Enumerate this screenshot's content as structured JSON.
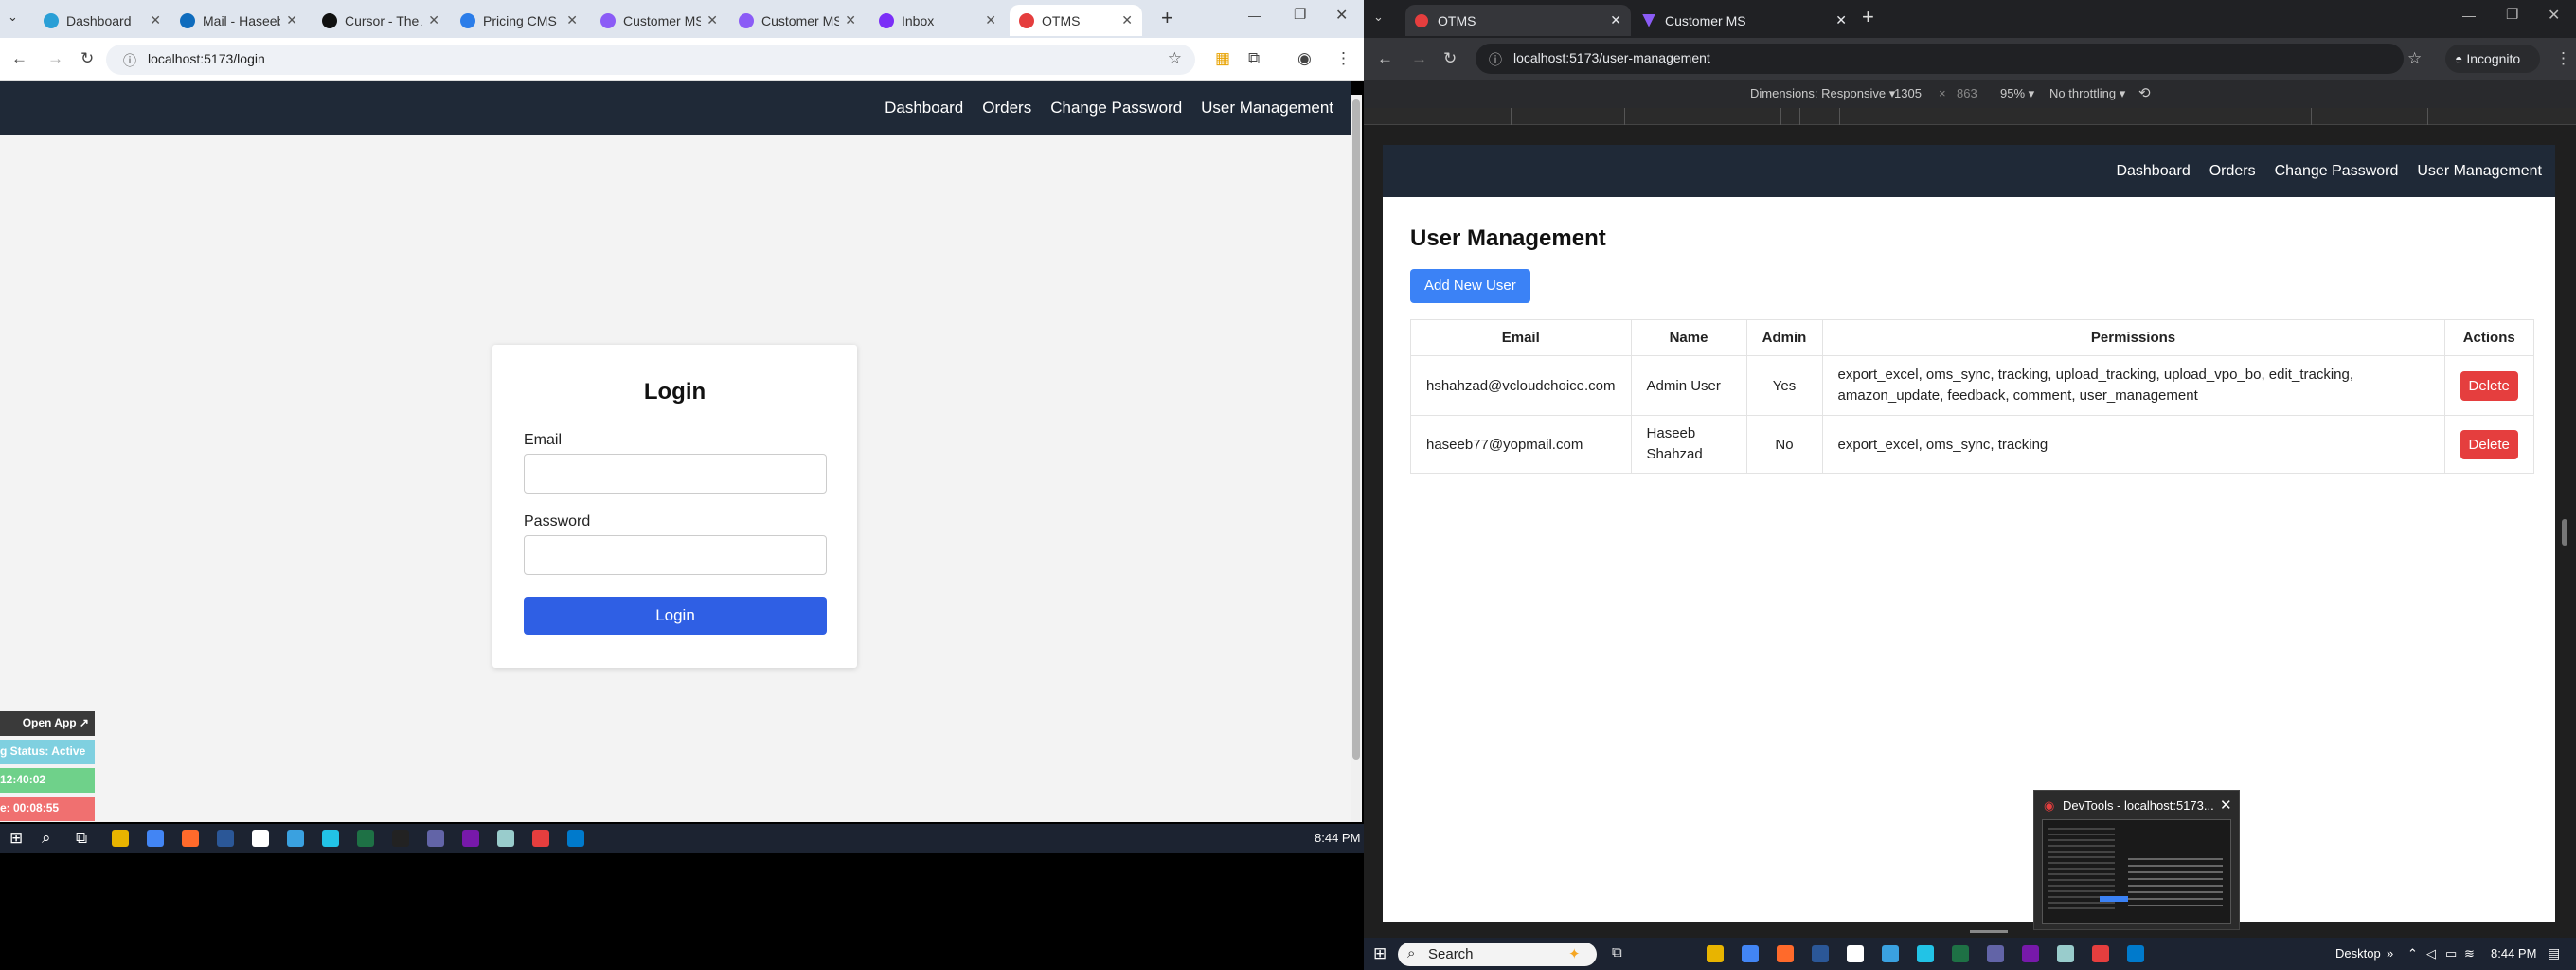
{
  "left": {
    "tabs": [
      {
        "label": "Dashboard",
        "color": "#2a9fd6"
      },
      {
        "label": "Mail - Haseeb",
        "color": "#0f6cbd"
      },
      {
        "label": "Cursor - The A",
        "color": "#111111"
      },
      {
        "label": "Pricing CMS",
        "color": "#2b7de9"
      },
      {
        "label": "Customer MS",
        "color": "#8b5cf6"
      },
      {
        "label": "Customer MS",
        "color": "#8b5cf6"
      },
      {
        "label": "Inbox",
        "color": "#7b2ff7"
      },
      {
        "label": "OTMS",
        "color": "#e53e3e"
      }
    ],
    "url": "localhost:5173/login",
    "nav": [
      "Dashboard",
      "Orders",
      "Change Password",
      "User Management"
    ],
    "login": {
      "title": "Login",
      "email_label": "Email",
      "password_label": "Password",
      "button": "Login"
    },
    "widgets": {
      "open_app": "Open App ↗",
      "status": "g Status: Active",
      "timer1": "12:40:02",
      "timer2": "e: 00:08:55"
    },
    "clock": "8:44 PM"
  },
  "right": {
    "tabs": [
      "OTMS",
      "Customer MS"
    ],
    "url": "localhost:5173/user-management",
    "incognito": "Incognito",
    "devtools": {
      "dimensions": "Dimensions: Responsive",
      "width": "1305",
      "height": "863",
      "zoom": "95%",
      "throttle": "No throttling"
    },
    "nav": [
      "Dashboard",
      "Orders",
      "Change Password",
      "User Management"
    ],
    "page_title": "User Management",
    "add_button": "Add New User",
    "table": {
      "headers": [
        "Email",
        "Name",
        "Admin",
        "Permissions",
        "Actions"
      ],
      "rows": [
        {
          "email": "hshahzad@vcloudchoice.com",
          "name": "Admin User",
          "admin": "Yes",
          "permissions": "export_excel, oms_sync, tracking, upload_tracking, upload_vpo_bo, edit_tracking, amazon_update, feedback, comment, user_management",
          "action": "Delete"
        },
        {
          "email": "haseeb77@yopmail.com",
          "name": "Haseeb Shahzad",
          "admin": "No",
          "permissions": "export_excel, oms_sync, tracking",
          "action": "Delete"
        }
      ]
    },
    "popup_title": "DevTools - localhost:5173...",
    "taskbar": {
      "search": "Search",
      "desktop": "Desktop",
      "clock": "8:44 PM"
    }
  }
}
